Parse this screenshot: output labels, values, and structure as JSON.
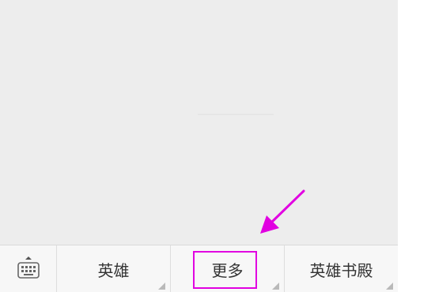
{
  "menu_bar": {
    "keyboard_toggle_icon": "keyboard-icon",
    "items": [
      {
        "label": "英雄"
      },
      {
        "label": "更多"
      },
      {
        "label": "英雄书殿"
      }
    ]
  },
  "annotation": {
    "highlight_color": "#e100e1",
    "arrow_color": "#e100e1"
  }
}
